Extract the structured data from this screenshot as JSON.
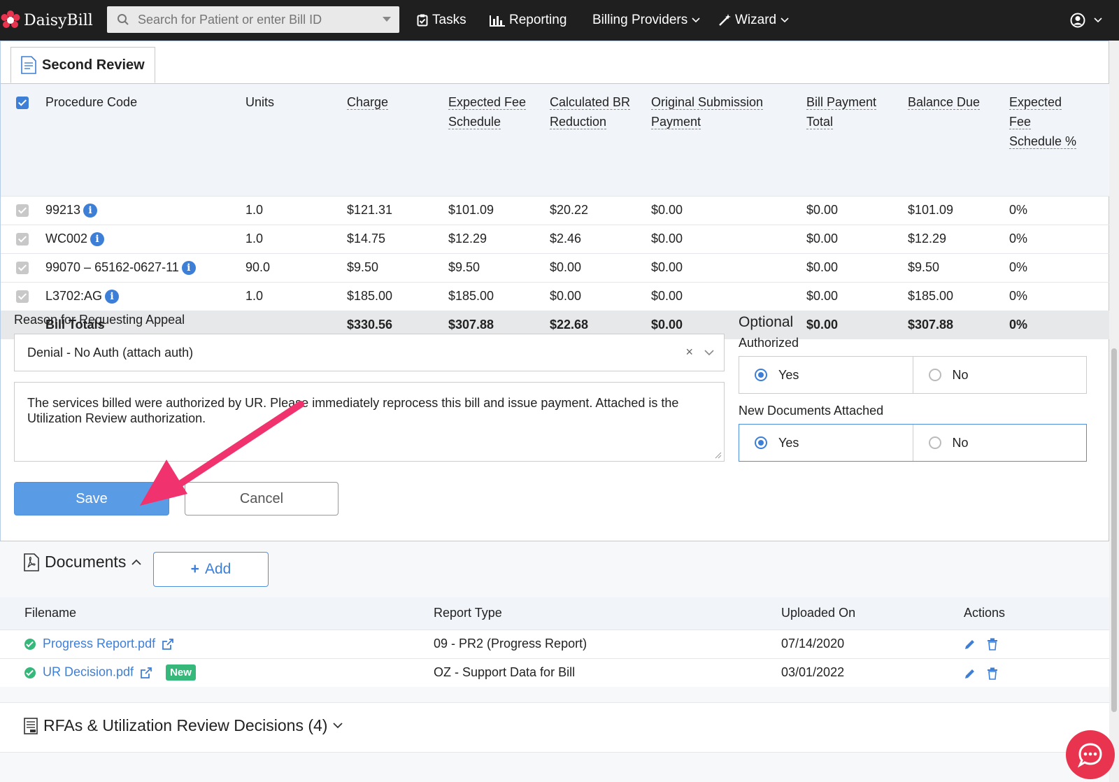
{
  "nav": {
    "brand": "DaisyBill",
    "search_placeholder": "Search for Patient or enter Bill ID",
    "tasks": "Tasks",
    "reporting": "Reporting",
    "billing_providers": "Billing Providers",
    "wizard": "Wizard"
  },
  "review_tab": "Second Review",
  "procedures": {
    "headers": {
      "code": "Procedure Code",
      "units": "Units",
      "charge": "Charge",
      "fee_1": "Expected Fee",
      "fee_2": "Schedule",
      "br_1": "Calculated BR",
      "br_2": "Reduction",
      "orig_1": "Original Submission",
      "orig_2": "Payment",
      "pay_1": "Bill Payment",
      "pay_2": "Total",
      "bal": "Balance Due",
      "pct_1": "Expected",
      "pct_2": "Fee",
      "pct_3": "Schedule %"
    },
    "rows": [
      {
        "code": "99213",
        "units": "1.0",
        "charge": "$121.31",
        "fee": "$101.09",
        "br": "$20.22",
        "orig": "$0.00",
        "pay": "$0.00",
        "bal": "$101.09",
        "pct": "0%"
      },
      {
        "code": "WC002",
        "units": "1.0",
        "charge": "$14.75",
        "fee": "$12.29",
        "br": "$2.46",
        "orig": "$0.00",
        "pay": "$0.00",
        "bal": "$12.29",
        "pct": "0%"
      },
      {
        "code": "99070 – 65162-0627-11",
        "units": "90.0",
        "charge": "$9.50",
        "fee": "$9.50",
        "br": "$0.00",
        "orig": "$0.00",
        "pay": "$0.00",
        "bal": "$9.50",
        "pct": "0%"
      },
      {
        "code": "L3702:AG",
        "units": "1.0",
        "charge": "$185.00",
        "fee": "$185.00",
        "br": "$0.00",
        "orig": "$0.00",
        "pay": "$0.00",
        "bal": "$185.00",
        "pct": "0%"
      }
    ],
    "totals": {
      "label": "Bill Totals",
      "charge": "$330.56",
      "fee": "$307.88",
      "br": "$22.68",
      "orig": "$0.00",
      "pay": "$0.00",
      "bal": "$307.88",
      "pct": "0%"
    }
  },
  "appeal": {
    "reason_label": "Reason for Requesting Appeal",
    "reason_value": "Denial - No Auth (attach auth)",
    "clear_symbol": "×",
    "message": "The services billed were authorized by UR. Please immediately reprocess this bill and issue payment. Attached is the Utilization Review authorization.",
    "optional_label": "Optional",
    "authorized_label": "Authorized",
    "new_docs_label": "New Documents Attached",
    "yes": "Yes",
    "no": "No",
    "authorized_selected": "Yes",
    "new_docs_selected": "Yes",
    "save": "Save",
    "cancel": "Cancel"
  },
  "documents": {
    "title": "Documents",
    "add": "Add",
    "headers": {
      "filename": "Filename",
      "report_type": "Report Type",
      "uploaded_on": "Uploaded On",
      "actions": "Actions"
    },
    "rows": [
      {
        "filename": "Progress Report.pdf",
        "report_type": "09 - PR2 (Progress Report)",
        "uploaded_on": "07/14/2020",
        "badge": ""
      },
      {
        "filename": "UR Decision.pdf",
        "report_type": "OZ - Support Data for Bill",
        "uploaded_on": "03/01/2022",
        "badge": "New"
      }
    ]
  },
  "rfa": {
    "title": "RFAs & Utilization Review Decisions (4)"
  },
  "colors": {
    "accent": "#3d7fd6",
    "save_button": "#5a9be6",
    "success": "#35b87a",
    "annotation_arrow": "#f0336e",
    "chat": "#e8344e"
  }
}
